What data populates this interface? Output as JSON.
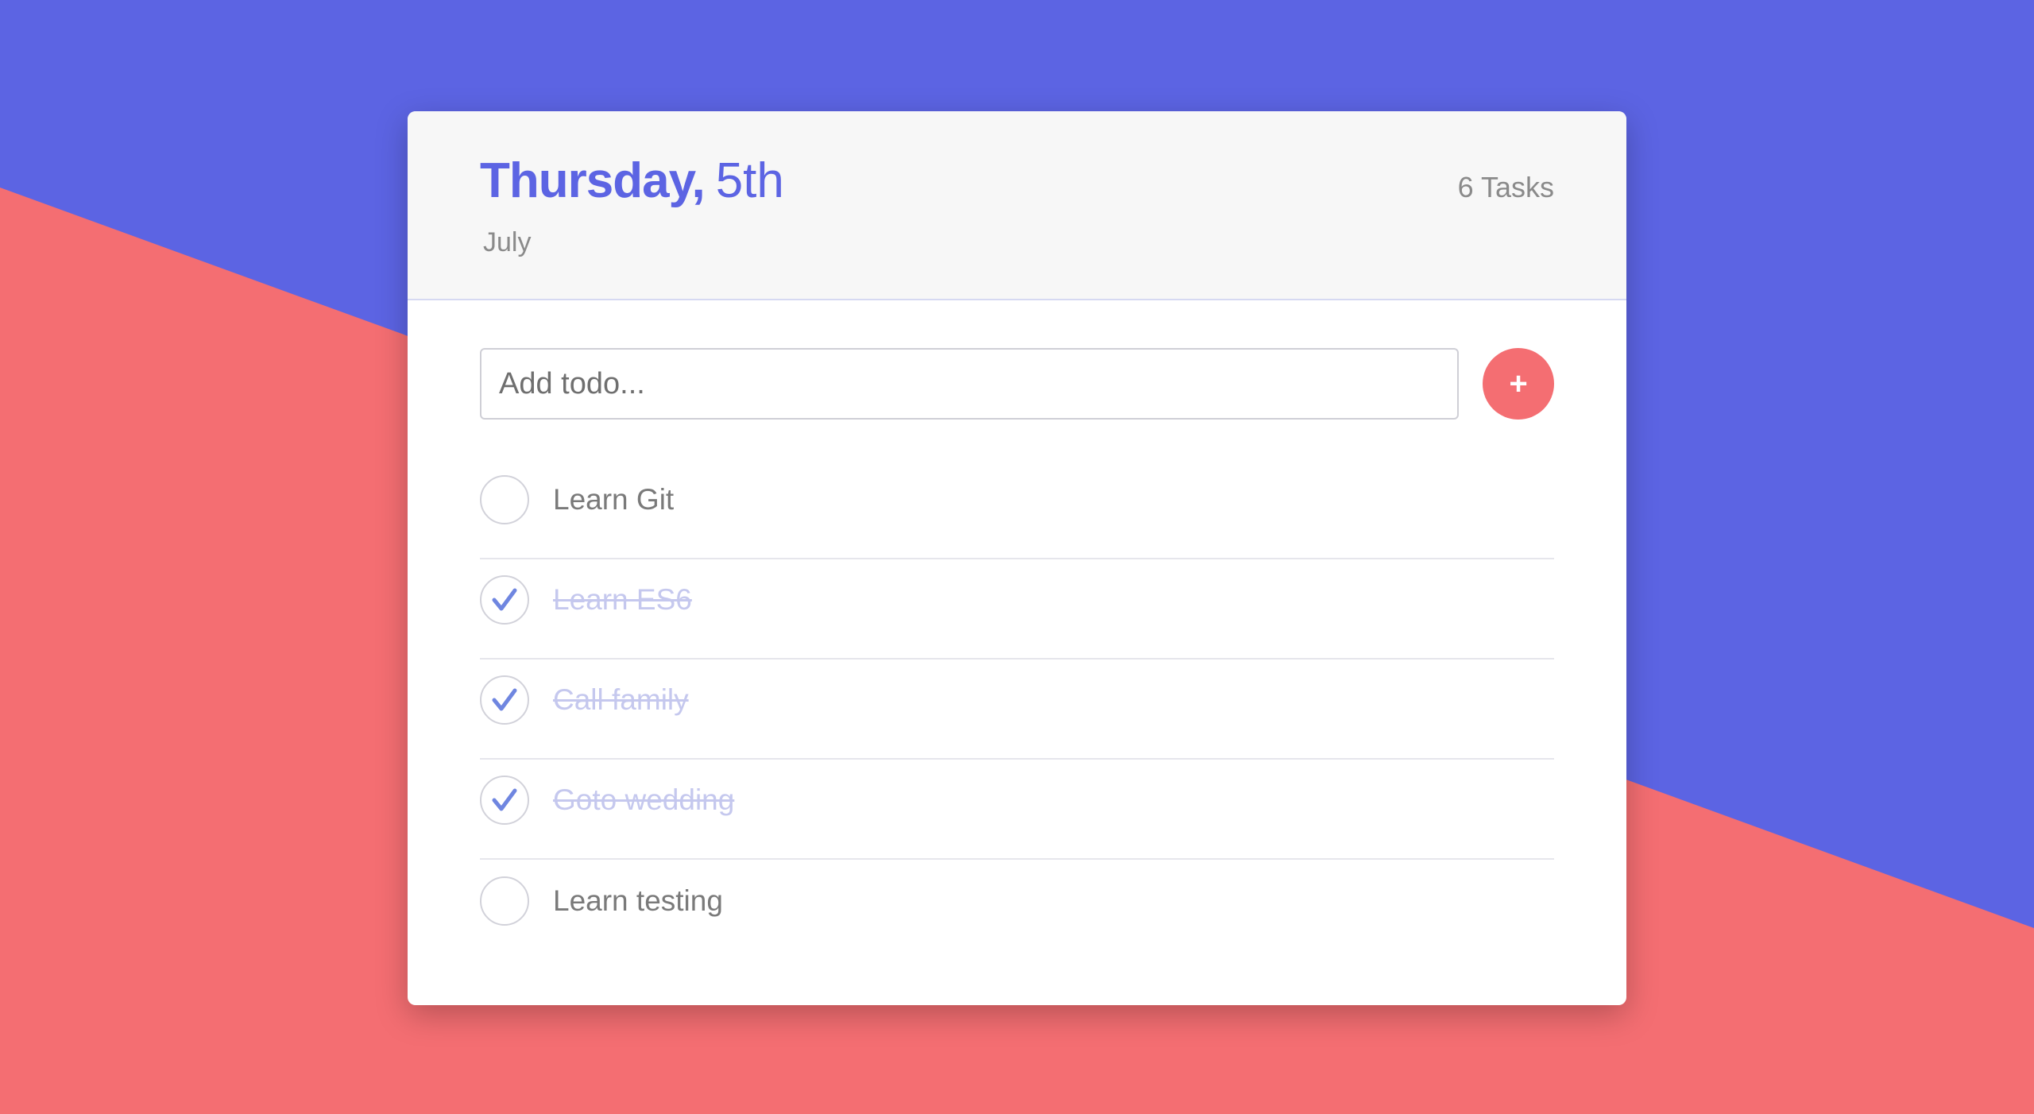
{
  "colors": {
    "accent": "#5c64e3",
    "coral": "#f46e72",
    "done_text": "#c5c8ee",
    "check": "#6f86e0"
  },
  "header": {
    "day": "Thursday,",
    "date": "5th",
    "month": "July",
    "task_count": "6 Tasks"
  },
  "add": {
    "placeholder": "Add todo...",
    "button_label": "+"
  },
  "todos": [
    {
      "label": "Learn Git",
      "done": false
    },
    {
      "label": "Learn ES6",
      "done": true
    },
    {
      "label": "Call family",
      "done": true
    },
    {
      "label": "Goto wedding",
      "done": true
    },
    {
      "label": "Learn testing",
      "done": false
    }
  ]
}
